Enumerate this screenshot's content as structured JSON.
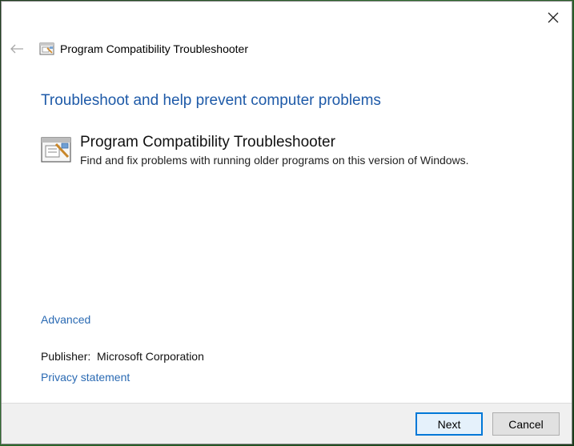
{
  "window": {
    "title": "Program Compatibility Troubleshooter",
    "close_icon": "close-icon",
    "back_icon": "back-arrow-icon"
  },
  "main": {
    "heading": "Troubleshoot and help prevent computer problems",
    "troubleshooter": {
      "name": "Program Compatibility Troubleshooter",
      "description": "Find and fix problems with running older programs on this version of Windows.",
      "icon": "program-compatibility-icon"
    },
    "advanced_link": "Advanced",
    "publisher_label": "Publisher:",
    "publisher_value": "Microsoft Corporation",
    "privacy_link": "Privacy statement"
  },
  "footer": {
    "next_label": "Next",
    "cancel_label": "Cancel"
  },
  "colors": {
    "heading": "#1e5aa8",
    "link": "#2a6ab3",
    "primary_border": "#0078d7",
    "footer_bg": "#f0f0f0"
  }
}
